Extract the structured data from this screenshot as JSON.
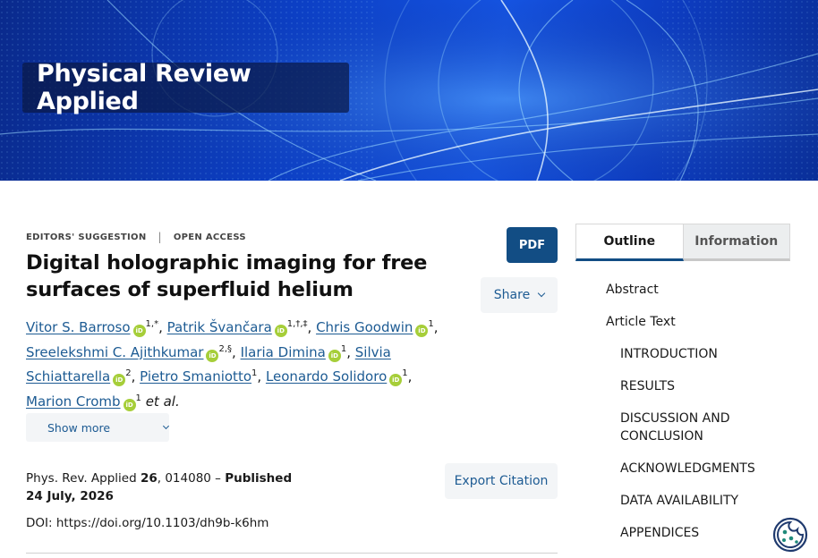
{
  "banner": {
    "journal_title": "Physical Review Applied"
  },
  "article": {
    "tags": [
      "EDITORS' SUGGESTION",
      "OPEN ACCESS"
    ],
    "title_line1": "Digital holographic imaging for free",
    "title_line2": "surfaces of superfluid helium",
    "authors": [
      {
        "name": "Vitor S. Barroso",
        "aff": "1,*"
      },
      {
        "name": "Patrik Švančara",
        "aff": "1,†,‡"
      },
      {
        "name": "Chris Goodwin",
        "aff": "1"
      },
      {
        "name": "Sreelekshmi C. Ajithkumar",
        "aff": "2,§"
      },
      {
        "name": "Ilaria Dimina",
        "aff": "1"
      },
      {
        "name": "Silvia",
        "name_cont": "Schiattarella",
        "aff": "2"
      },
      {
        "name": "Pietro Smaniotto",
        "aff": "1"
      },
      {
        "name": "Leonardo Solidoro",
        "aff": "1"
      },
      {
        "name": "Marion Cromb",
        "aff": "1"
      }
    ],
    "orcid_label": "iD",
    "et_al": "et al.",
    "show_more": "Show more",
    "citation": {
      "journal": "Phys. Rev. Applied",
      "volume": "26",
      "article_no": ", 014080 –",
      "published_label": "Published",
      "date": "24 July, 2026"
    },
    "doi": "DOI: https://doi.org/10.1103/dh9b-k6hm"
  },
  "buttons": {
    "pdf": "PDF",
    "share": "Share",
    "export": "Export Citation"
  },
  "sidebar": {
    "tabs": [
      "Outline",
      "Information"
    ],
    "outline": [
      {
        "label": "Abstract",
        "level": 1
      },
      {
        "label": "Article Text",
        "level": 1
      },
      {
        "label": "INTRODUCTION",
        "level": 2
      },
      {
        "label": "RESULTS",
        "level": 2
      },
      {
        "label": "DISCUSSION AND CONCLUSION",
        "level": 2
      },
      {
        "label": "ACKNOWLEDGMENTS",
        "level": 2
      },
      {
        "label": "DATA AVAILABILITY",
        "level": 2
      },
      {
        "label": "APPENDICES",
        "level": 2
      }
    ]
  },
  "colors": {
    "brand_blue": "#124d84",
    "link_blue": "#1d5b93",
    "orcid_green": "#a6ce39"
  }
}
